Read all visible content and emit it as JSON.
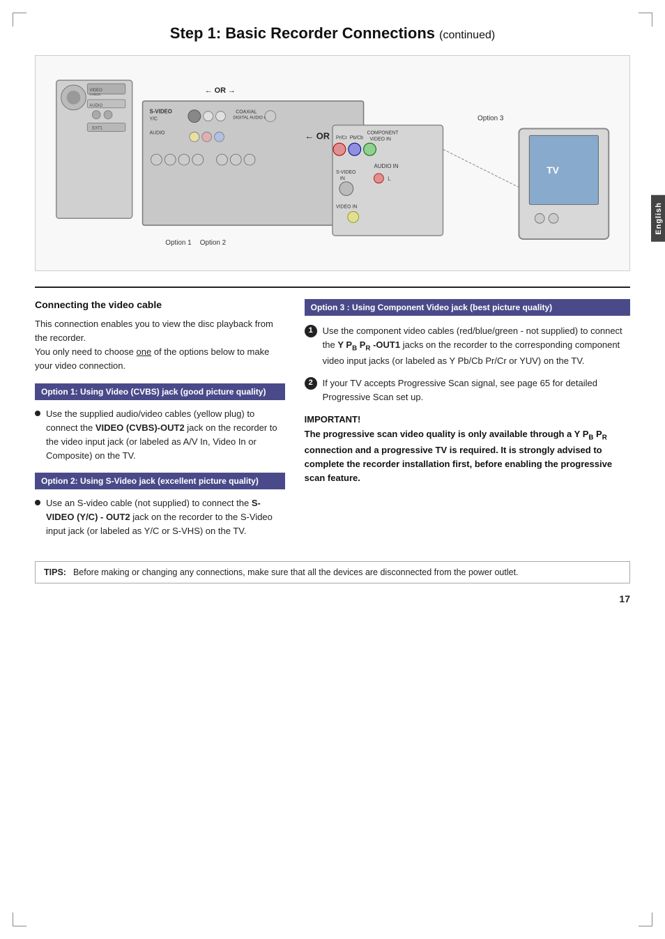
{
  "page": {
    "title": "Step 1: Basic Recorder Connections",
    "title_continued": "(continued)",
    "page_number": "17"
  },
  "english_tab": "English",
  "left_column": {
    "section_title": "Connecting the video cable",
    "intro": "This connection enables you to view the disc playback from the recorder.\nYou only need to choose one of the options below to make your video connection.",
    "option1_box": "Option 1: Using Video (CVBS) jack (good picture quality)",
    "option1_bullet": "Use the supplied audio/video cables (yellow plug) to connect the VIDEO (CVBS)-OUT2 jack on the recorder to the video input jack (or labeled as A/V In, Video In or Composite) on the TV.",
    "option2_box": "Option 2: Using S-Video jack (excellent picture quality)",
    "option2_bullet": "Use an S-video cable (not supplied) to connect the S-VIDEO (Y/C) - OUT2 jack on the recorder to the S-Video input jack (or labeled as Y/C or S-VHS) on the TV."
  },
  "right_column": {
    "option3_header": "Option 3 : Using Component Video jack (best picture quality)",
    "item1": "Use the component video cables (red/blue/green - not supplied) to connect the Y PB PR -OUT1 jacks on the recorder to the corresponding component video input jacks (or labeled as Y Pb/Cb Pr/Cr or YUV) on the TV.",
    "item1_bold": "Y PB PR -OUT1",
    "item2": "If your TV accepts Progressive Scan signal, see page 65 for detailed Progressive Scan set up.",
    "important_label": "IMPORTANT!",
    "important_text": "The progressive scan video quality is only available through a Y PB PR connection and a progressive TV is required. It is strongly advised to complete the recorder installation first, before enabling the progressive scan feature."
  },
  "tips": {
    "label": "TIPS:",
    "text": "Before making or changing any connections, make sure that all the devices are disconnected from the power outlet."
  },
  "diagram": {
    "option1_label": "Option 1",
    "option2_label": "Option 2",
    "option3_label": "Option 3",
    "or_label_top": "OR",
    "or_label_bottom": "OR"
  }
}
